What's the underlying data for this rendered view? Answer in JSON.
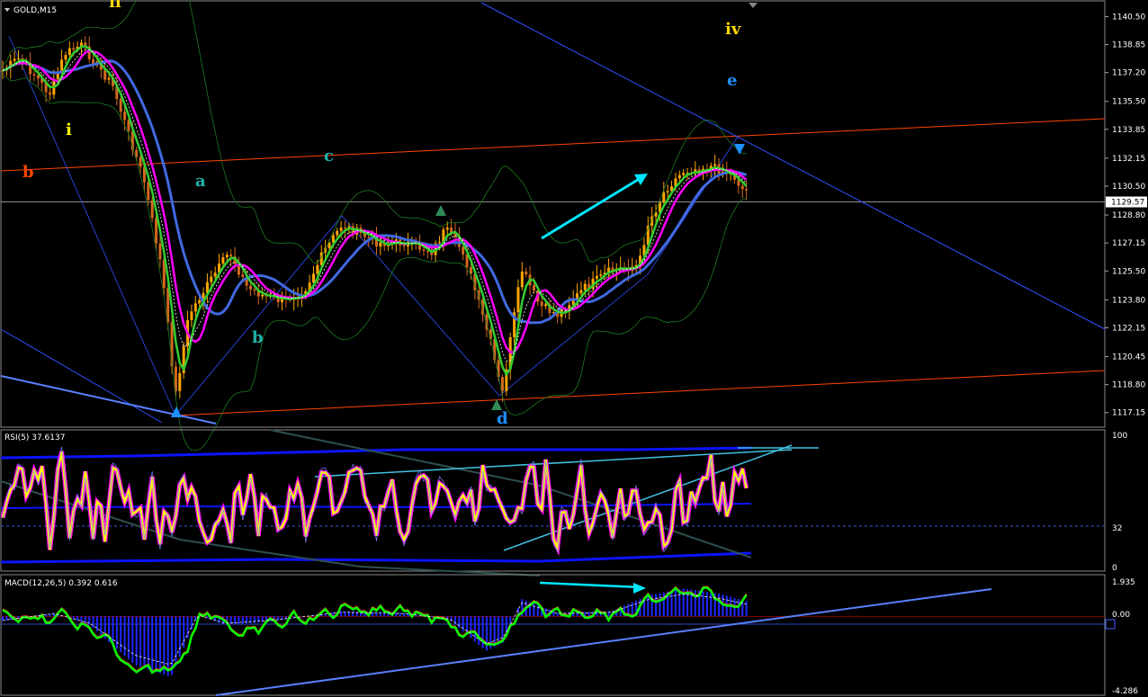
{
  "window": {
    "symbol_timeframe": "GOLD,M15",
    "menu_arrow_icon": "triangle-down-icon"
  },
  "price_panel": {
    "price_labels": [
      "1140.50",
      "1138.85",
      "1137.20",
      "1135.50",
      "1133.85",
      "1132.15",
      "1130.50",
      "1128.80",
      "1127.15",
      "1125.50",
      "1123.80",
      "1122.15",
      "1120.45",
      "1118.80",
      "1117.15"
    ],
    "current_price": "1129.57",
    "wave_labels": {
      "ii": "ii",
      "i": "i",
      "b_orange": "b",
      "a": "a",
      "c": "c",
      "b": "b",
      "d": "d",
      "iv": "iv",
      "e": "e"
    },
    "colors": {
      "bull_candle": "#FFA500",
      "bear_candle": "#D2691E",
      "ma_fast": "#32CD32",
      "ma_mid": "#FF00FF",
      "ma_slow": "#4169E1",
      "channel": "#FF4500",
      "trendline": "#1E50FF",
      "arrow": "#00E5FF"
    }
  },
  "rsi_panel": {
    "title": "RSI(5) 37.6137",
    "scale_labels": [
      "100",
      "32",
      "0"
    ],
    "colors": {
      "rsi": "#FFFF00",
      "rsi_glow": "#FF00FF",
      "bands": "#0A14FF"
    }
  },
  "macd_panel": {
    "title": "MACD(12,26,5) 0.392 0.616",
    "scale_labels": [
      "1.935",
      "0.00",
      "-4.286"
    ],
    "colors": {
      "hist": "#1E28FF",
      "signal": "#00FF00",
      "macd": "#FF3030"
    }
  },
  "chart_data": [
    {
      "type": "candlestick",
      "title": "GOLD,M15",
      "ylim": [
        1116.5,
        1141.0
      ],
      "y_ticks": [
        1140.5,
        1138.85,
        1137.2,
        1135.5,
        1133.85,
        1132.15,
        1130.5,
        1128.8,
        1127.15,
        1125.5,
        1123.8,
        1122.15,
        1120.45,
        1118.8,
        1117.15
      ],
      "current_price": 1129.57,
      "approx_close_path": [
        1137.5,
        1138.5,
        1137.2,
        1136.0,
        1133.5,
        1130.5,
        1126.0,
        1121.0,
        1117.8,
        1121.5,
        1124.5,
        1126.5,
        1125.0,
        1124.2,
        1125.2,
        1124.0,
        1125.0,
        1128.0,
        1128.5,
        1127.8,
        1128.0,
        1127.5,
        1126.5,
        1128.5,
        1127.2,
        1124.0,
        1121.5,
        1118.8,
        1122.0,
        1126.0,
        1124.5,
        1123.0,
        1124.0,
        1125.5,
        1126.0,
        1126.5,
        1129.5,
        1131.5,
        1132.5,
        1131.0,
        1131.5,
        1130.8,
        1130.2
      ]
    },
    {
      "type": "line",
      "title": "RSI(5) 37.6137",
      "ylim": [
        0,
        100
      ],
      "levels": [
        32
      ],
      "current": 37.6137
    },
    {
      "type": "bar",
      "title": "MACD(12,26,5) 0.392 0.616",
      "ylim": [
        -4.286,
        1.935
      ],
      "macd": 0.392,
      "signal": 0.616
    }
  ]
}
